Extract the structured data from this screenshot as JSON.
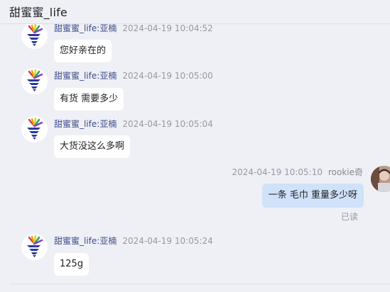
{
  "header": {
    "title": "甜蜜蜜_life"
  },
  "messages": [
    {
      "direction": "incoming",
      "sender": "甜蜜蜜_life:亚楠",
      "time": "2024-04-19 10:04:52",
      "text": "您好亲在的"
    },
    {
      "direction": "incoming",
      "sender": "甜蜜蜜_life:亚楠",
      "time": "2024-04-19 10:05:00",
      "text": "有货  需要多少"
    },
    {
      "direction": "incoming",
      "sender": "甜蜜蜜_life:亚楠",
      "time": "2024-04-19 10:05:04",
      "text": "大货没这么多啊"
    },
    {
      "direction": "outgoing",
      "sender": "rookie奇",
      "time": "2024-04-19 10:05:10",
      "text": "一条  毛巾 重量多少呀",
      "status": "已读"
    },
    {
      "direction": "incoming",
      "sender": "甜蜜蜜_life:亚楠",
      "time": "2024-04-19 10:05:24",
      "text": "125g"
    }
  ],
  "colors": {
    "background": "#eef0f5",
    "incoming_bubble": "#ffffff",
    "outgoing_bubble": "#cfe2fa",
    "sender_name": "#3d4a8a",
    "timestamp": "#999999"
  },
  "icons": {
    "seller_avatar": "shop-logo-avatar",
    "user_avatar": "user-photo-avatar"
  }
}
